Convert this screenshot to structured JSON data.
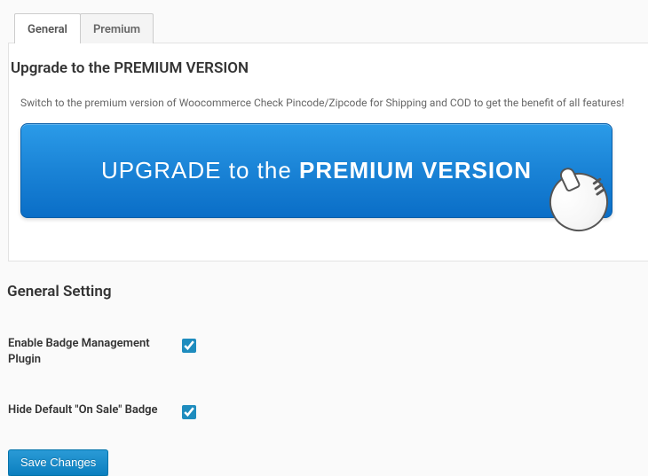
{
  "tabs": [
    {
      "label": "General",
      "active": true
    },
    {
      "label": "Premium",
      "active": false
    }
  ],
  "upgrade": {
    "heading": "Upgrade to the PREMIUM VERSION",
    "description": "Switch to the premium version of Woocommerce Check Pincode/Zipcode for Shipping and COD to get the benefit of all features!",
    "button_leading": "UPGRADE to the ",
    "button_strong": "PREMIUM VERSION"
  },
  "general_settings": {
    "heading": "General Setting",
    "fields": [
      {
        "key": "enable",
        "label": "Enable Badge Management Plugin",
        "checked": true
      },
      {
        "key": "hide_sale",
        "label": "Hide Default \"On Sale\" Badge",
        "checked": true
      }
    ]
  },
  "save_button": "Save Changes"
}
